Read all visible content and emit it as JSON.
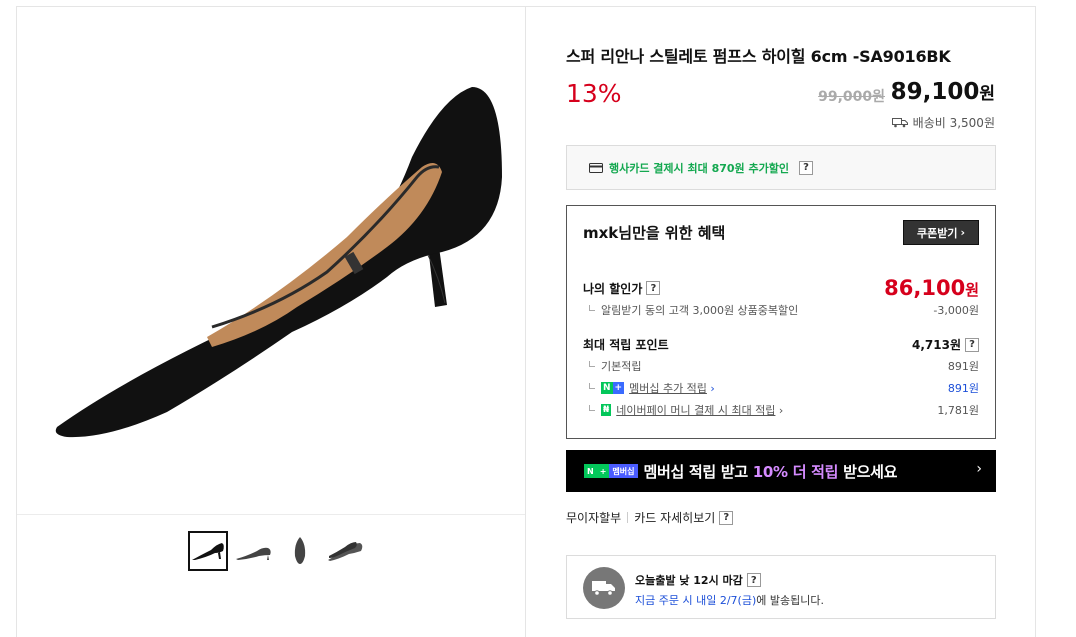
{
  "product": {
    "title": "스퍼 리안나 스틸레토 펌프스 하이힐 6cm -SA9016BK",
    "discount_rate": "13%",
    "original_price": "99,000원",
    "sale_price": "89,100",
    "sale_price_unit": "원",
    "shipping": "배송비 3,500원"
  },
  "card_promo": {
    "text": "행사카드 결제시 최대 870원 추가할인",
    "help": "?"
  },
  "benefit": {
    "title": "mxk님만을 위한 혜택",
    "coupon_button": "쿠폰받기",
    "my_price_label": "나의 할인가",
    "my_price": "86,100",
    "my_price_unit": "원",
    "alarm_label": "알림받기 동의 고객 3,000원 상품중복할인",
    "alarm_value": "-3,000원",
    "max_points_label": "최대 적립 포인트",
    "max_points_value": "4,713원",
    "basic_label": "기본적립",
    "basic_value": "891원",
    "membership_label": "멤버십 추가 적립",
    "membership_value": "891원",
    "naverpay_label": "네이버페이 머니 결제 시 최대 적립",
    "naverpay_value": "1,781원",
    "help": "?"
  },
  "banner": {
    "tag_n": "N",
    "tag_plus": "+",
    "tag_label": "멤버십",
    "msg_pre": "멤버십 적립 받고 ",
    "msg_hl": "10% 더 적립",
    "msg_post": " 받으세요",
    "arrow": "›"
  },
  "installments": {
    "label1": "무이자할부",
    "label2": "카드 자세히보기",
    "help": "?"
  },
  "delivery": {
    "title": "오늘출발 낮 12시 마감",
    "help": "?",
    "desc_hl": "지금 주문 시 내일 2/7(금)",
    "desc_rest": "에 발송됩니다."
  },
  "icons": {
    "card": "credit-card-icon",
    "truck": "truck-icon",
    "ship": "delivery-truck-icon"
  },
  "colors": {
    "accent_red": "#d6001c",
    "naver_green": "#03c75a",
    "link_blue": "#1c4fd8"
  }
}
